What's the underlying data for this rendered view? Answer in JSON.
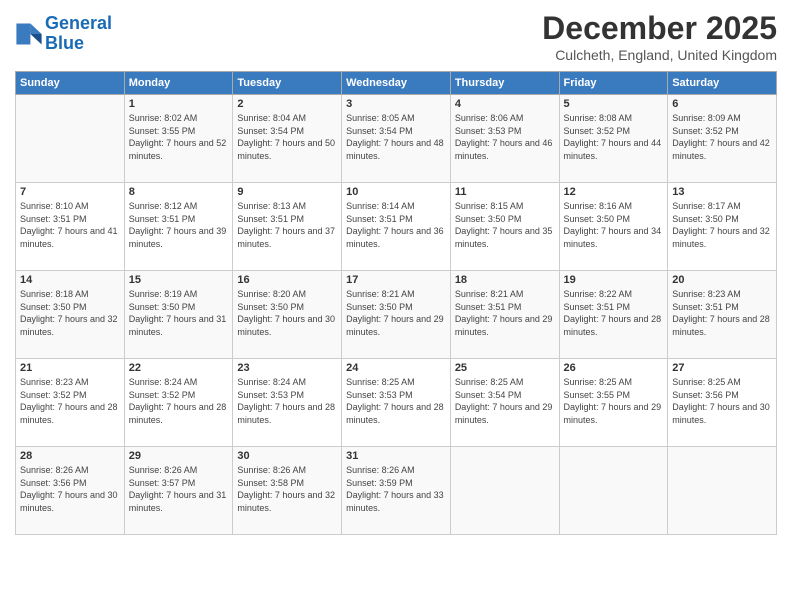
{
  "header": {
    "logo_line1": "General",
    "logo_line2": "Blue",
    "title": "December 2025",
    "location": "Culcheth, England, United Kingdom"
  },
  "weekdays": [
    "Sunday",
    "Monday",
    "Tuesday",
    "Wednesday",
    "Thursday",
    "Friday",
    "Saturday"
  ],
  "weeks": [
    [
      {
        "day": "",
        "sunrise": "",
        "sunset": "",
        "daylight": ""
      },
      {
        "day": "1",
        "sunrise": "Sunrise: 8:02 AM",
        "sunset": "Sunset: 3:55 PM",
        "daylight": "Daylight: 7 hours and 52 minutes."
      },
      {
        "day": "2",
        "sunrise": "Sunrise: 8:04 AM",
        "sunset": "Sunset: 3:54 PM",
        "daylight": "Daylight: 7 hours and 50 minutes."
      },
      {
        "day": "3",
        "sunrise": "Sunrise: 8:05 AM",
        "sunset": "Sunset: 3:54 PM",
        "daylight": "Daylight: 7 hours and 48 minutes."
      },
      {
        "day": "4",
        "sunrise": "Sunrise: 8:06 AM",
        "sunset": "Sunset: 3:53 PM",
        "daylight": "Daylight: 7 hours and 46 minutes."
      },
      {
        "day": "5",
        "sunrise": "Sunrise: 8:08 AM",
        "sunset": "Sunset: 3:52 PM",
        "daylight": "Daylight: 7 hours and 44 minutes."
      },
      {
        "day": "6",
        "sunrise": "Sunrise: 8:09 AM",
        "sunset": "Sunset: 3:52 PM",
        "daylight": "Daylight: 7 hours and 42 minutes."
      }
    ],
    [
      {
        "day": "7",
        "sunrise": "Sunrise: 8:10 AM",
        "sunset": "Sunset: 3:51 PM",
        "daylight": "Daylight: 7 hours and 41 minutes."
      },
      {
        "day": "8",
        "sunrise": "Sunrise: 8:12 AM",
        "sunset": "Sunset: 3:51 PM",
        "daylight": "Daylight: 7 hours and 39 minutes."
      },
      {
        "day": "9",
        "sunrise": "Sunrise: 8:13 AM",
        "sunset": "Sunset: 3:51 PM",
        "daylight": "Daylight: 7 hours and 37 minutes."
      },
      {
        "day": "10",
        "sunrise": "Sunrise: 8:14 AM",
        "sunset": "Sunset: 3:51 PM",
        "daylight": "Daylight: 7 hours and 36 minutes."
      },
      {
        "day": "11",
        "sunrise": "Sunrise: 8:15 AM",
        "sunset": "Sunset: 3:50 PM",
        "daylight": "Daylight: 7 hours and 35 minutes."
      },
      {
        "day": "12",
        "sunrise": "Sunrise: 8:16 AM",
        "sunset": "Sunset: 3:50 PM",
        "daylight": "Daylight: 7 hours and 34 minutes."
      },
      {
        "day": "13",
        "sunrise": "Sunrise: 8:17 AM",
        "sunset": "Sunset: 3:50 PM",
        "daylight": "Daylight: 7 hours and 32 minutes."
      }
    ],
    [
      {
        "day": "14",
        "sunrise": "Sunrise: 8:18 AM",
        "sunset": "Sunset: 3:50 PM",
        "daylight": "Daylight: 7 hours and 32 minutes."
      },
      {
        "day": "15",
        "sunrise": "Sunrise: 8:19 AM",
        "sunset": "Sunset: 3:50 PM",
        "daylight": "Daylight: 7 hours and 31 minutes."
      },
      {
        "day": "16",
        "sunrise": "Sunrise: 8:20 AM",
        "sunset": "Sunset: 3:50 PM",
        "daylight": "Daylight: 7 hours and 30 minutes."
      },
      {
        "day": "17",
        "sunrise": "Sunrise: 8:21 AM",
        "sunset": "Sunset: 3:50 PM",
        "daylight": "Daylight: 7 hours and 29 minutes."
      },
      {
        "day": "18",
        "sunrise": "Sunrise: 8:21 AM",
        "sunset": "Sunset: 3:51 PM",
        "daylight": "Daylight: 7 hours and 29 minutes."
      },
      {
        "day": "19",
        "sunrise": "Sunrise: 8:22 AM",
        "sunset": "Sunset: 3:51 PM",
        "daylight": "Daylight: 7 hours and 28 minutes."
      },
      {
        "day": "20",
        "sunrise": "Sunrise: 8:23 AM",
        "sunset": "Sunset: 3:51 PM",
        "daylight": "Daylight: 7 hours and 28 minutes."
      }
    ],
    [
      {
        "day": "21",
        "sunrise": "Sunrise: 8:23 AM",
        "sunset": "Sunset: 3:52 PM",
        "daylight": "Daylight: 7 hours and 28 minutes."
      },
      {
        "day": "22",
        "sunrise": "Sunrise: 8:24 AM",
        "sunset": "Sunset: 3:52 PM",
        "daylight": "Daylight: 7 hours and 28 minutes."
      },
      {
        "day": "23",
        "sunrise": "Sunrise: 8:24 AM",
        "sunset": "Sunset: 3:53 PM",
        "daylight": "Daylight: 7 hours and 28 minutes."
      },
      {
        "day": "24",
        "sunrise": "Sunrise: 8:25 AM",
        "sunset": "Sunset: 3:53 PM",
        "daylight": "Daylight: 7 hours and 28 minutes."
      },
      {
        "day": "25",
        "sunrise": "Sunrise: 8:25 AM",
        "sunset": "Sunset: 3:54 PM",
        "daylight": "Daylight: 7 hours and 29 minutes."
      },
      {
        "day": "26",
        "sunrise": "Sunrise: 8:25 AM",
        "sunset": "Sunset: 3:55 PM",
        "daylight": "Daylight: 7 hours and 29 minutes."
      },
      {
        "day": "27",
        "sunrise": "Sunrise: 8:25 AM",
        "sunset": "Sunset: 3:56 PM",
        "daylight": "Daylight: 7 hours and 30 minutes."
      }
    ],
    [
      {
        "day": "28",
        "sunrise": "Sunrise: 8:26 AM",
        "sunset": "Sunset: 3:56 PM",
        "daylight": "Daylight: 7 hours and 30 minutes."
      },
      {
        "day": "29",
        "sunrise": "Sunrise: 8:26 AM",
        "sunset": "Sunset: 3:57 PM",
        "daylight": "Daylight: 7 hours and 31 minutes."
      },
      {
        "day": "30",
        "sunrise": "Sunrise: 8:26 AM",
        "sunset": "Sunset: 3:58 PM",
        "daylight": "Daylight: 7 hours and 32 minutes."
      },
      {
        "day": "31",
        "sunrise": "Sunrise: 8:26 AM",
        "sunset": "Sunset: 3:59 PM",
        "daylight": "Daylight: 7 hours and 33 minutes."
      },
      {
        "day": "",
        "sunrise": "",
        "sunset": "",
        "daylight": ""
      },
      {
        "day": "",
        "sunrise": "",
        "sunset": "",
        "daylight": ""
      },
      {
        "day": "",
        "sunrise": "",
        "sunset": "",
        "daylight": ""
      }
    ]
  ]
}
